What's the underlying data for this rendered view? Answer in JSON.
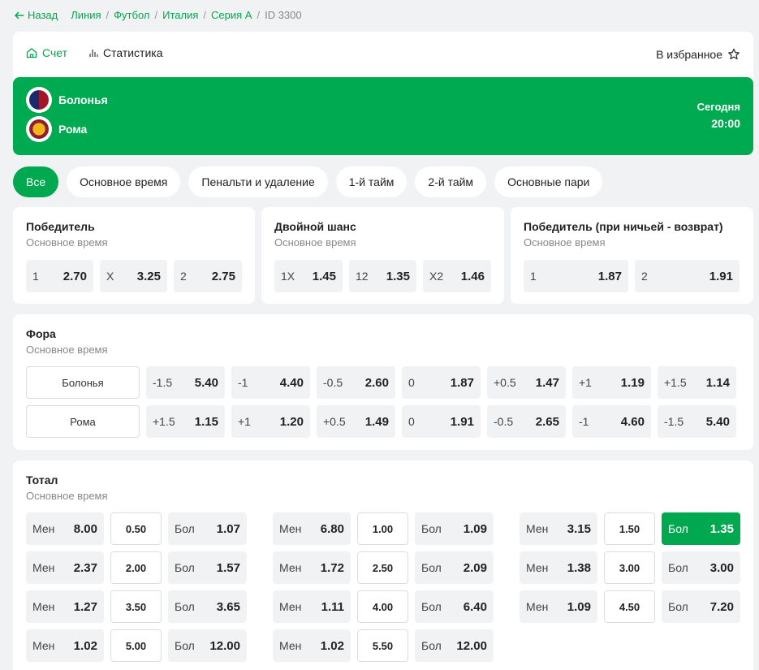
{
  "breadcrumb": {
    "back_label": "Назад",
    "items": [
      "Линия",
      "Футбол",
      "Италия",
      "Серия А"
    ],
    "id_label": "ID 3300"
  },
  "header": {
    "tab_score": "Счет",
    "tab_stats": "Статистика",
    "favorite_label": "В избранное"
  },
  "match": {
    "home": "Болонья",
    "away": "Рома",
    "day": "Сегодня",
    "time": "20:00"
  },
  "filters": [
    "Все",
    "Основное время",
    "Пенальти и удаление",
    "1-й тайм",
    "2-й тайм",
    "Основные пари"
  ],
  "markets": {
    "winner": {
      "title": "Победитель",
      "sub": "Основное время",
      "odds": [
        {
          "l": "1",
          "v": "2.70"
        },
        {
          "l": "X",
          "v": "3.25"
        },
        {
          "l": "2",
          "v": "2.75"
        }
      ]
    },
    "double": {
      "title": "Двойной шанс",
      "sub": "Основное время",
      "odds": [
        {
          "l": "1X",
          "v": "1.45"
        },
        {
          "l": "12",
          "v": "1.35"
        },
        {
          "l": "X2",
          "v": "1.46"
        }
      ]
    },
    "dnb": {
      "title": "Победитель (при ничьей - возврат)",
      "sub": "Основное время",
      "odds": [
        {
          "l": "1",
          "v": "1.87"
        },
        {
          "l": "2",
          "v": "1.91"
        }
      ]
    },
    "handicap": {
      "title": "Фора",
      "sub": "Основное время",
      "rows": [
        {
          "team": "Болонья",
          "odds": [
            {
              "l": "-1.5",
              "v": "5.40"
            },
            {
              "l": "-1",
              "v": "4.40"
            },
            {
              "l": "-0.5",
              "v": "2.60"
            },
            {
              "l": "0",
              "v": "1.87"
            },
            {
              "l": "+0.5",
              "v": "1.47"
            },
            {
              "l": "+1",
              "v": "1.19"
            },
            {
              "l": "+1.5",
              "v": "1.14"
            }
          ]
        },
        {
          "team": "Рома",
          "odds": [
            {
              "l": "+1.5",
              "v": "1.15"
            },
            {
              "l": "+1",
              "v": "1.20"
            },
            {
              "l": "+0.5",
              "v": "1.49"
            },
            {
              "l": "0",
              "v": "1.91"
            },
            {
              "l": "-0.5",
              "v": "2.65"
            },
            {
              "l": "-1",
              "v": "4.60"
            },
            {
              "l": "-1.5",
              "v": "5.40"
            }
          ]
        }
      ]
    },
    "total": {
      "title": "Тотал",
      "sub": "Основное время",
      "under_label": "Мен",
      "over_label": "Бол",
      "columns": [
        [
          {
            "line": "0.50",
            "u": "8.00",
            "o": "1.07"
          },
          {
            "line": "2.00",
            "u": "2.37",
            "o": "1.57"
          },
          {
            "line": "3.50",
            "u": "1.27",
            "o": "3.65"
          },
          {
            "line": "5.00",
            "u": "1.02",
            "o": "12.00"
          }
        ],
        [
          {
            "line": "1.00",
            "u": "6.80",
            "o": "1.09"
          },
          {
            "line": "2.50",
            "u": "1.72",
            "o": "2.09"
          },
          {
            "line": "4.00",
            "u": "1.11",
            "o": "6.40"
          },
          {
            "line": "5.50",
            "u": "1.02",
            "o": "12.00"
          }
        ],
        [
          {
            "line": "1.50",
            "u": "3.15",
            "o": "1.35",
            "selected_over": true
          },
          {
            "line": "3.00",
            "u": "1.38",
            "o": "3.00"
          },
          {
            "line": "4.50",
            "u": "1.09",
            "o": "7.20"
          }
        ]
      ]
    }
  },
  "colors": {
    "accent": "#00a84f",
    "match_bg": "#00aa50",
    "page_bg": "#f1f2f4"
  }
}
